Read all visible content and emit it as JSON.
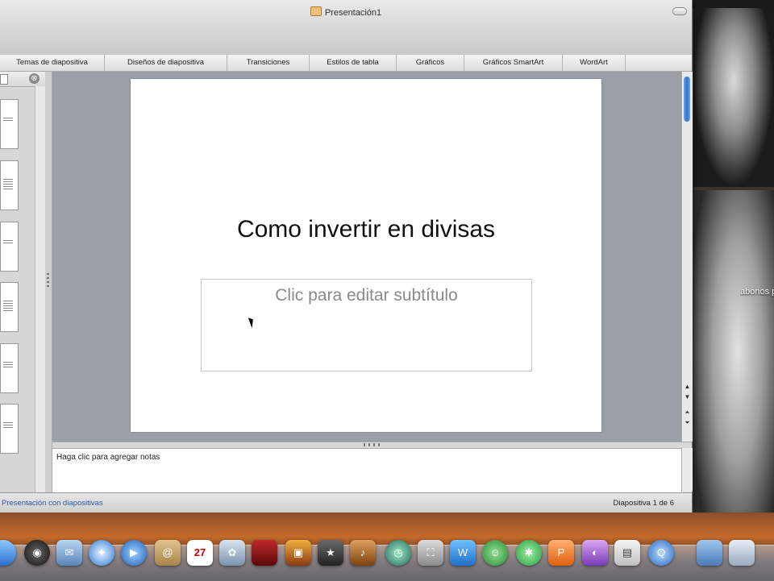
{
  "window": {
    "title": "Presentación1"
  },
  "ribbon": {
    "tabs": [
      "Temas de diapositiva",
      "Diseños de diapositiva",
      "Transiciones",
      "Estilos de tabla",
      "Gráficos",
      "Gráficos SmartArt",
      "WordArt"
    ]
  },
  "slide": {
    "title": "Como invertir en divisas",
    "subtitle_placeholder": "Clic para editar subtítulo"
  },
  "notes": {
    "placeholder": "Haga clic para agregar notas"
  },
  "status": {
    "view_mode": "Presentación con diapositivas",
    "slide_position": "Diapositiva 1 de 6"
  },
  "sorter": {
    "close_glyph": "⊗",
    "thumbnail_count": 6
  },
  "calendar": {
    "day": "27"
  },
  "desktop": {
    "label": "abonos plugin"
  },
  "dock": {
    "icons": [
      "finder-icon",
      "dashboard-icon",
      "mail-icon",
      "safari-icon",
      "ichat-icon",
      "address-book-icon",
      "ical-icon",
      "iphoto-icon",
      "photo-booth-icon",
      "image-capture-icon",
      "imovie-icon",
      "garageband-icon",
      "time-machine-icon",
      "preview-icon",
      "messenger-icon",
      "contacts-icon",
      "network-icon",
      "word-icon",
      "powerpoint-icon",
      "document-icon",
      "quicktime-icon",
      "folder-icon",
      "downloads-icon"
    ]
  }
}
